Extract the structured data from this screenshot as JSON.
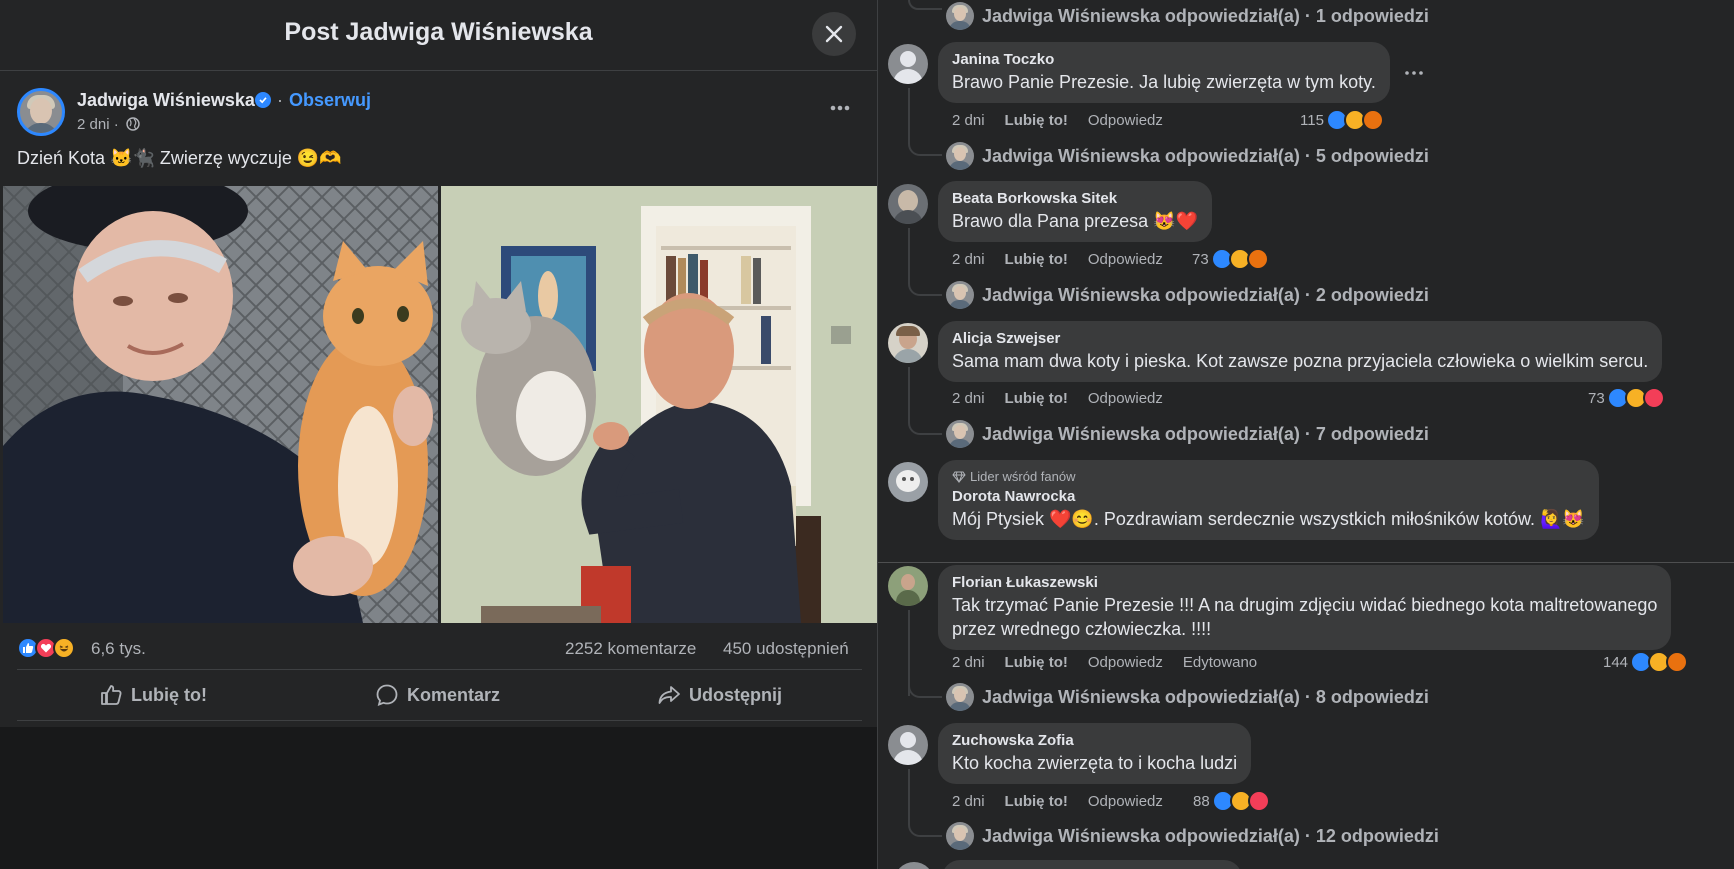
{
  "post_header": {
    "title": "Post Jadwiga Wiśniewska"
  },
  "author": {
    "name": "Jadwiga Wiśniewska",
    "separator": "·",
    "follow_label": "Obserwuj",
    "time": "2 dni ·"
  },
  "post": {
    "text": "Dzień Kota 🐱🐈‍⬛ Zwierzę wyczuje 😉🫶"
  },
  "reactions_summary": {
    "count": "6,6 tys.",
    "comments": "2252 komentarze",
    "shares": "450 udostępnień"
  },
  "actions": {
    "like": "Lubię to!",
    "comment": "Komentarz",
    "share": "Udostępnij"
  },
  "top_replies": {
    "text": "Jadwiga Wiśniewska odpowiedział(a) · 1 odpowiedzi"
  },
  "comments": [
    {
      "name": "Janina Toczko",
      "text": "Brawo Panie Prezesie. Ja lubię zwierzęta w tym koty.",
      "time": "2 dni",
      "like": "Lubię to!",
      "reply": "Odpowiedz",
      "reaction_count": "115",
      "replies": "Jadwiga Wiśniewska odpowiedział(a) · 5 odpowiedzi"
    },
    {
      "name": "Beata Borkowska Sitek",
      "text": "Brawo dla Pana prezesa 😻❤️",
      "time": "2 dni",
      "like": "Lubię to!",
      "reply": "Odpowiedz",
      "reaction_count": "73",
      "replies": "Jadwiga Wiśniewska odpowiedział(a) · 2 odpowiedzi"
    },
    {
      "name": "Alicja Szwejser",
      "text": "Sama mam dwa koty i pieska. Kot zawsze pozna przyjaciela człowieka o wielkim sercu.",
      "time": "2 dni",
      "like": "Lubię to!",
      "reply": "Odpowiedz",
      "reaction_count": "73",
      "replies": "Jadwiga Wiśniewska odpowiedział(a) · 7 odpowiedzi"
    },
    {
      "badge": "Lider wśród fanów",
      "name": "Dorota Nawrocka",
      "text": "Mój Ptysiek ❤️😊. Pozdrawiam serdecznie wszystkich miłośników kotów. 🙋‍♀️😻"
    },
    {
      "name": "Florian Łukaszewski",
      "text_line1": "Tak trzymać Panie Prezesie !!! A na drugim zdjęciu widać biednego kota maltretowanego",
      "text_line2": "przez wrednego człowieczka. !!!!",
      "time": "2 dni",
      "like": "Lubię to!",
      "reply": "Odpowiedz",
      "edited": "Edytowano",
      "reaction_count": "144",
      "replies": "Jadwiga Wiśniewska odpowiedział(a) · 8 odpowiedzi"
    },
    {
      "name": "Zuchowska Zofia",
      "text": "Kto kocha zwierzęta to i kocha ludzi",
      "time": "2 dni",
      "like": "Lubię to!",
      "reply": "Odpowiedz",
      "reaction_count": "88",
      "replies": "Jadwiga Wiśniewska odpowiedział(a) · 12 odpowiedzi"
    }
  ],
  "icons": {
    "close": "close-icon",
    "verified": "verified-badge-icon",
    "globe": "globe-icon",
    "more": "more-options-icon",
    "like": "thumbs-up-icon",
    "comment": "comment-bubble-icon",
    "share": "share-arrow-icon",
    "fan_badge": "diamond-icon"
  },
  "colors": {
    "background": "#242526",
    "bubble": "#3a3b3c",
    "accent_blue": "#2d88ff",
    "link_blue": "#4599ff",
    "text_primary": "#e4e6eb",
    "text_secondary": "#b0b3b8"
  }
}
